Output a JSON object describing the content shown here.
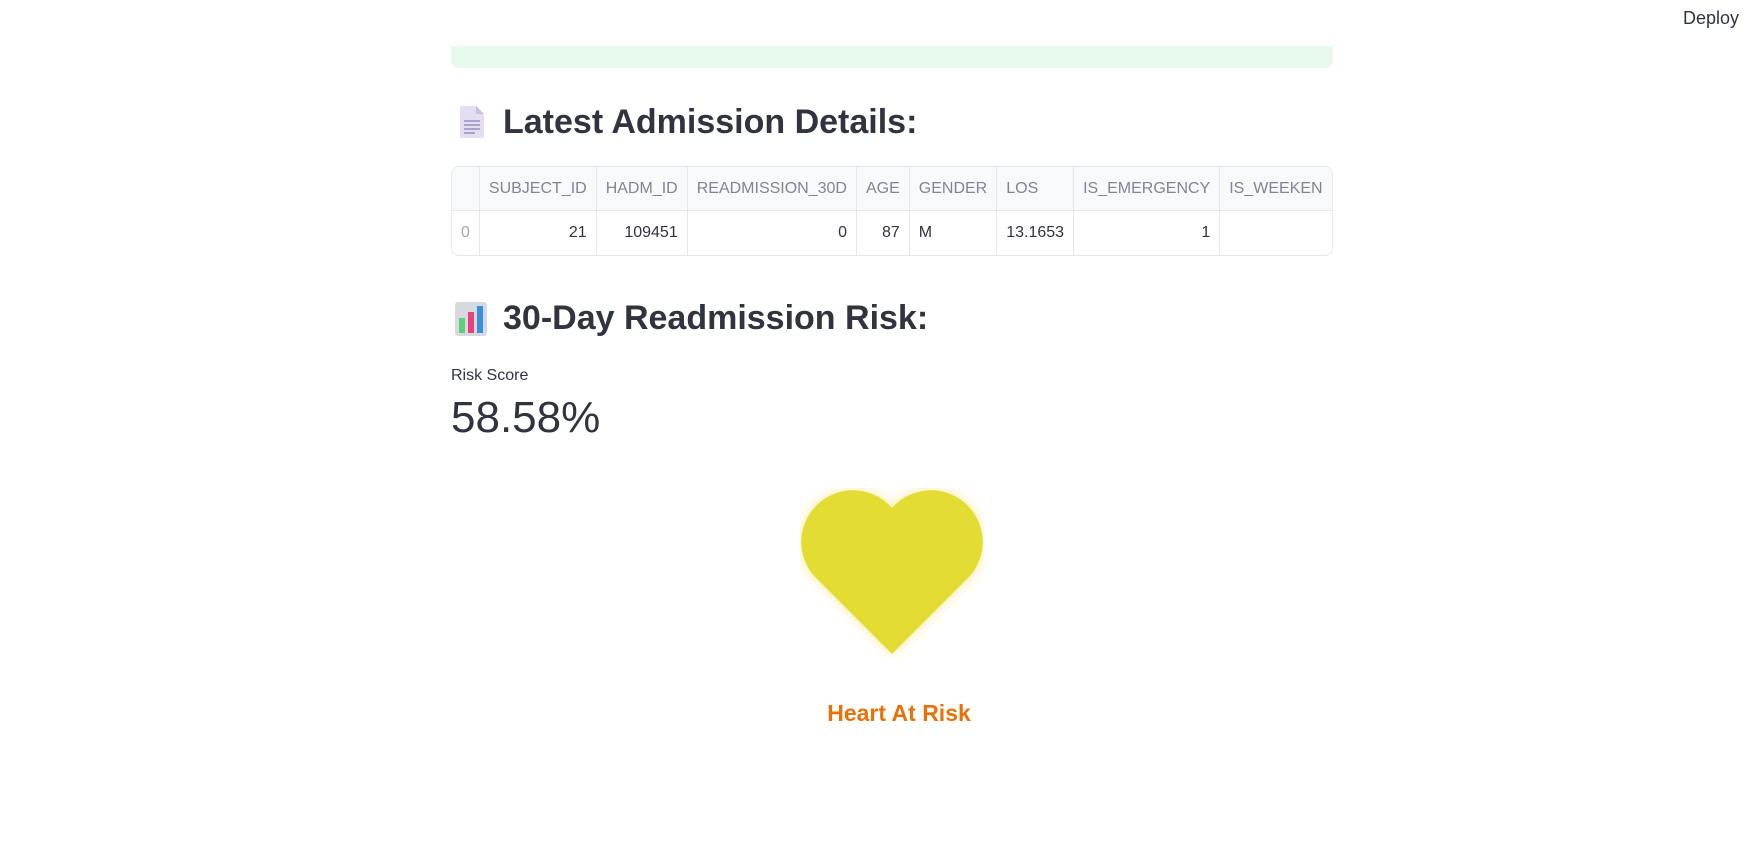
{
  "toolbar": {
    "deploy_label": "Deploy"
  },
  "section_admission": {
    "title": "Latest Admission Details:",
    "icon": "page-document-icon"
  },
  "admission_table": {
    "columns": [
      "",
      "SUBJECT_ID",
      "HADM_ID",
      "READMISSION_30D",
      "AGE",
      "GENDER",
      "LOS",
      "IS_EMERGENCY",
      "IS_WEEKEN"
    ],
    "rows": [
      [
        "0",
        "21",
        "109451",
        "0",
        "87",
        "M",
        "13.1653",
        "1",
        ""
      ]
    ]
  },
  "section_risk": {
    "title": "30-Day Readmission Risk:",
    "icon": "bar-chart-icon"
  },
  "metric": {
    "label": "Risk Score",
    "value": "58.58%"
  },
  "heart": {
    "color": "#e3dc33",
    "status": "Heart At Risk",
    "status_color": "#e8710a"
  },
  "colors": {
    "success_bg": "#e8f9ee",
    "text": "#31333f"
  }
}
